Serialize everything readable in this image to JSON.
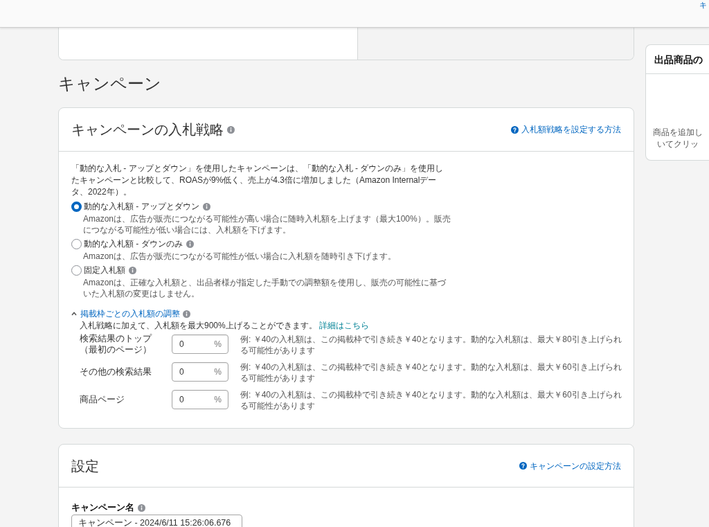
{
  "header": {
    "link": "キ"
  },
  "page_title": "キャンペーン",
  "bidding_card": {
    "title": "キャンペーンの入札戦略",
    "help_link": "入札額戦略を設定する方法",
    "intro": "「動的な入札 - アップとダウン」を使用したキャンペーンは、「動的な入札 - ダウンのみ」を使用したキャンペーンと比較して、ROASが9%低く、売上が4.3倍に増加しました（Amazon Internalデータ、2022年）。",
    "strategies": [
      {
        "label": "動的な入札額 - アップとダウン",
        "description": "Amazonは、広告が販売につながる可能性が高い場合に随時入札額を上げます（最大100%）。販売につながる可能性が低い場合には、入札額を下げます。",
        "selected": true
      },
      {
        "label": "動的な入札額 - ダウンのみ",
        "description": "Amazonは、広告が販売につながる可能性が低い場合に入札額を随時引き下げます。",
        "selected": false
      },
      {
        "label": "固定入札額",
        "description": "Amazonは、正確な入札額と、出品者様が指定した手動での調整額を使用し、販売の可能性に基づいた入札額の変更はしません。",
        "selected": false
      }
    ],
    "placement_adjustment": {
      "toggle": "掲載枠ごとの入札額の調整",
      "expanded": true,
      "note": "入札戦略に加えて、入札額を最大900%上げることができます。",
      "details_link": "詳細はこちら",
      "rows": [
        {
          "label": "検索結果のトップ（最初のページ）",
          "value": "0",
          "unit": "%",
          "example": "例: ￥40の入札額は、この掲載枠で引き続き￥40となります。動的な入札額は、最大￥80引き上げられる可能性があります"
        },
        {
          "label": "その他の検索結果",
          "value": "0",
          "unit": "%",
          "example": "例: ￥40の入札額は、この掲載枠で引き続き￥40となります。動的な入札額は、最大￥60引き上げられる可能性があります"
        },
        {
          "label": "商品ページ",
          "value": "0",
          "unit": "%",
          "example": "例: ￥40の入札額は、この掲載枠で引き続き￥40となります。動的な入札額は、最大￥60引き上げられる可能性があります"
        }
      ]
    }
  },
  "settings_card": {
    "title": "設定",
    "help_link": "キャンペーンの設定方法",
    "campaign_name": {
      "label": "キャンペーン名",
      "value": "キャンペーン - 2024/6/11 15:26:06.676"
    }
  },
  "side_panel": {
    "title": "出品商品の",
    "text_lines": [
      "商品を追加し",
      "いてクリッ"
    ]
  }
}
